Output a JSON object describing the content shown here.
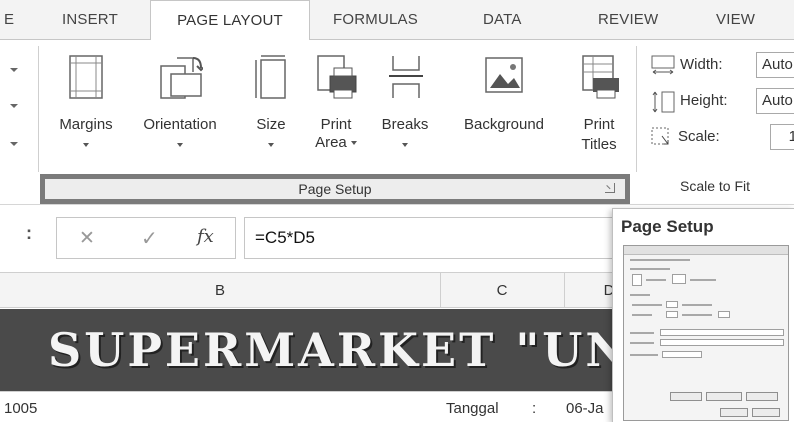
{
  "tabs": [
    {
      "label": "E"
    },
    {
      "label": "INSERT"
    },
    {
      "label": "PAGE LAYOUT"
    },
    {
      "label": "FORMULAS"
    },
    {
      "label": "DATA"
    },
    {
      "label": "REVIEW"
    },
    {
      "label": "VIEW"
    }
  ],
  "ribbon": {
    "buttons": {
      "margins": {
        "label": "Margins",
        "icon": "margins-icon"
      },
      "orientation": {
        "label": "Orientation",
        "icon": "orientation-icon"
      },
      "size": {
        "label": "Size",
        "icon": "size-icon"
      },
      "print_area": {
        "label": "Print",
        "label2": "Area",
        "icon": "print-area-icon"
      },
      "breaks": {
        "label": "Breaks",
        "icon": "breaks-icon"
      },
      "background": {
        "label": "Background",
        "icon": "background-icon"
      },
      "print_titles": {
        "label": "Print",
        "label2": "Titles",
        "icon": "print-titles-icon"
      }
    },
    "group_label": "Page Setup",
    "scale_to_fit": {
      "width_label": "Width:",
      "width_value": "Auto",
      "height_label": "Height:",
      "height_value": "Auto",
      "scale_label": "Scale:",
      "scale_value": "1",
      "group_label": "Scale to Fit"
    }
  },
  "formula_bar": {
    "more": ":",
    "cancel": "✕",
    "enter": "✓",
    "fx": "fx",
    "formula": "=C5*D5"
  },
  "columns": [
    {
      "label": "B"
    },
    {
      "label": "C"
    },
    {
      "label": "D"
    }
  ],
  "sheet": {
    "title_text": "SUPERMARKET \"UNGU",
    "row_left": "1005",
    "row_mid": "Tanggal",
    "row_colon": ":",
    "row_date": "06-Ja"
  },
  "tooltip": {
    "title": "Page Setup"
  },
  "colors": {
    "title_band": "#4a4a4a",
    "highlight_border": "#7b7b7b"
  }
}
